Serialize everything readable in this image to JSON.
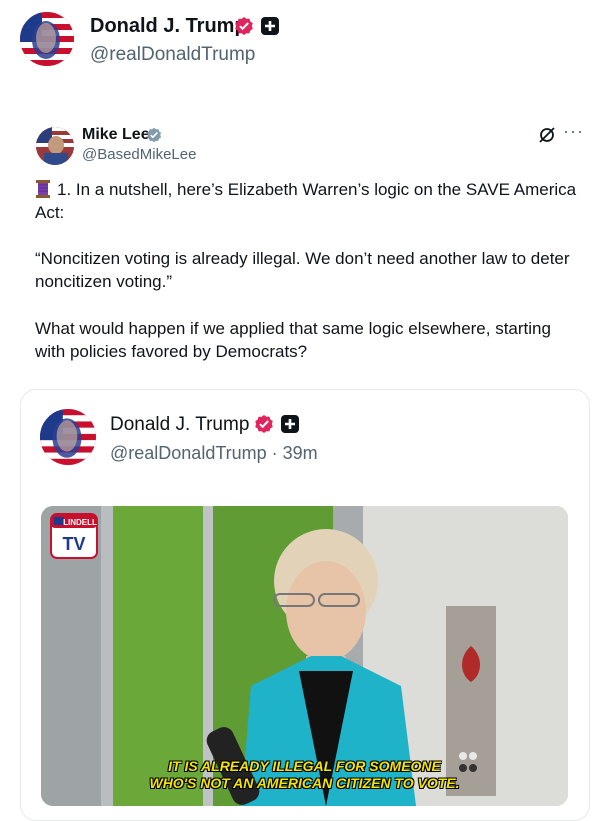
{
  "post": {
    "author_name": "Donald J. Trump",
    "author_handle": "@realDonaldTrump"
  },
  "quoted": {
    "author_name": "Mike Lee",
    "author_handle": "@BasedMikeLee",
    "more_label": "···",
    "para1": "1. In a nutshell, here’s Elizabeth Warren’s logic on the SAVE America Act:",
    "para2": "“Noncitizen voting is already illegal. We don’t need another law to deter noncitizen voting.”",
    "para3": "What would happen if we applied that same logic elsewhere, starting with policies favored by Democrats?"
  },
  "card": {
    "author_name": "Donald J. Trump",
    "author_handle": "@realDonaldTrump · 39m",
    "video_caption_line1": "IT IS ALREADY ILLEGAL FOR SOMEONE",
    "video_caption_line2": "WHO'S NOT AN AMERICAN CITIZEN TO VOTE.",
    "video_logo_top": "LINDELL",
    "video_logo_bottom": "TV"
  },
  "colors": {
    "verified_pink": "#e0245e",
    "verified_gray": "#829aab",
    "caption_yellow": "#f5e400",
    "jacket_teal": "#1fb3c9"
  }
}
